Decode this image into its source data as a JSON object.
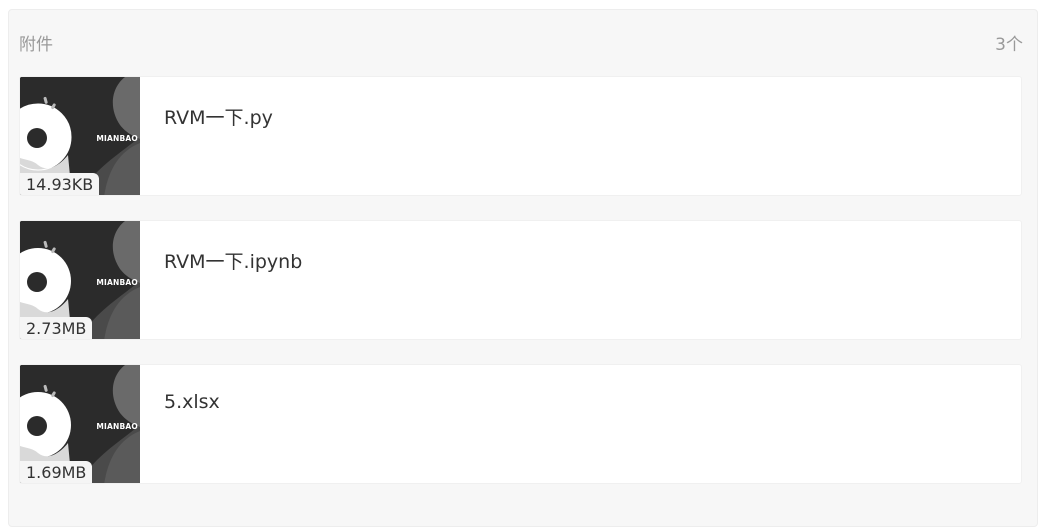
{
  "attachments": {
    "title": "附件",
    "count_label": "3个",
    "brand_text": "MIANBAO",
    "colors": {
      "panel_bg": "#f7f7f7",
      "thumb_bg": "#2b2b2b",
      "text": "#333333",
      "muted": "#999999"
    },
    "files": [
      {
        "name": "RVM一下.py",
        "size": "14.93KB",
        "icon": "donut-logo-icon"
      },
      {
        "name": "RVM一下.ipynb",
        "size": "2.73MB",
        "icon": "donut-logo-icon"
      },
      {
        "name": "5.xlsx",
        "size": "1.69MB",
        "icon": "donut-logo-icon"
      }
    ]
  }
}
